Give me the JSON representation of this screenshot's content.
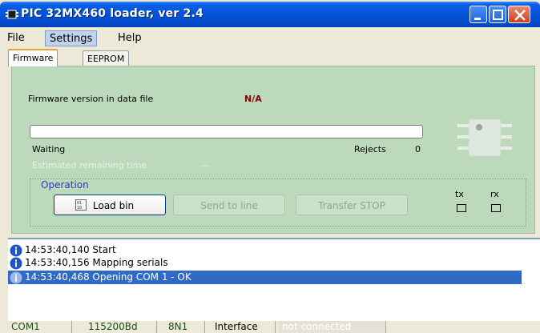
{
  "window": {
    "title": "PIC 32MX460 loader, ver 2.4"
  },
  "menu": {
    "file": "File",
    "settings": "Settings",
    "help": "Help"
  },
  "tabs": {
    "firmware": "Firmware",
    "eeprom": "EEPROM"
  },
  "firmware": {
    "version_label": "Firmware version in data file",
    "version_value": "N/A",
    "progress": 0,
    "status": "Waiting",
    "rejects_label": "Rejects",
    "rejects_value": "0",
    "est_label": "Estimated remaining time",
    "est_value": "---"
  },
  "operation": {
    "title": "Operation",
    "load_bin": "Load bin",
    "load_icon_text": "01\n10",
    "send_to_line": "Send to line",
    "transfer_stop": "Transfer STOP"
  },
  "indicators": {
    "tx": "tx",
    "rx": "rx"
  },
  "log": [
    {
      "text": "14:53:40,140 Start"
    },
    {
      "text": "14:53:40,156 Mapping serials"
    },
    {
      "text": "14:53:40,468  Opening COM 1 - OK"
    }
  ],
  "statusbar": {
    "port": "COM1",
    "baud": "115200Bd",
    "frame": "8N1",
    "interface": "Interface",
    "connection": "not connected"
  },
  "colors": {
    "panel": "#bcd9bc",
    "selection": "#316ac5",
    "titlebar": "#0553d8"
  }
}
